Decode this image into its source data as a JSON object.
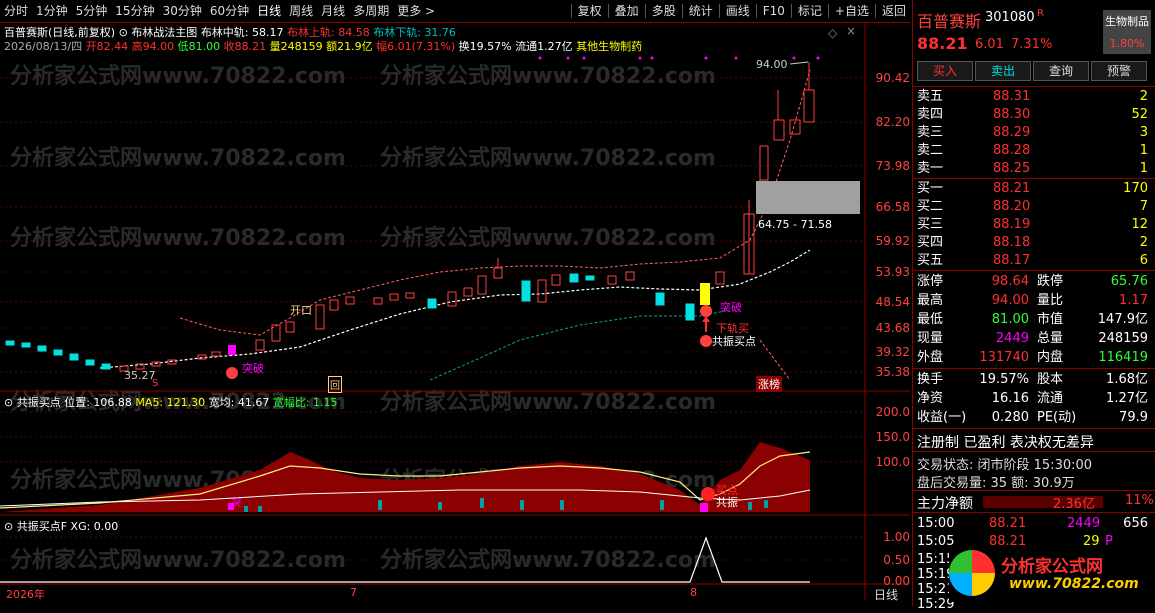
{
  "toolbar": {
    "periods": [
      "分时",
      "1分钟",
      "5分钟",
      "15分钟",
      "30分钟",
      "60分钟",
      "日线",
      "周线",
      "月线",
      "多周期",
      "更多 >"
    ],
    "actions": [
      "复权",
      "叠加",
      "多股",
      "统计",
      "画线",
      "F10",
      "标记",
      "+自选",
      "返回"
    ]
  },
  "header": {
    "stock": "百普赛斯(日线,前复权)",
    "indicator": "布林战法主图",
    "mid_label": "布林中轨: 58.17",
    "up_label": "布林上轨: 84.58",
    "down_label": "布林下轨: 31.76",
    "date": "2026/08/13/四",
    "open": "开82.44",
    "high": "高94.00",
    "low": "低81.00",
    "close": "收88.21",
    "vol": "量248159",
    "amount": "额21.9亿",
    "change": "幅6.01(7.31%)",
    "turnover": "换19.57%",
    "float": "流通1.27亿",
    "sector": "其他生物制药"
  },
  "price_axis": [
    "90.42",
    "82.20",
    "73.98",
    "66.58",
    "59.92",
    "53.93",
    "48.54",
    "43.68",
    "39.32",
    "35.38"
  ],
  "sub_axis1": [
    "200.0",
    "150.0",
    "100.0"
  ],
  "sub_axis2": [
    "1.00",
    "0.50",
    "0.00"
  ],
  "chart_labels": {
    "high_mark": "94.00",
    "gap_range": "64.75 - 71.58",
    "low_mark": "35.27",
    "breakout1": "突破",
    "breakout2": "突破",
    "sell_signal": "下轨买",
    "resonance": "共振买点",
    "limit": "涨榜",
    "open_tag": "开口",
    "s_tag": "S",
    "q_tag": "回",
    "sub_tag1": "共振",
    "sub_tag2": "买点",
    "sub_tag3": "突",
    "watermark": "分析家公式网www.70822.com"
  },
  "sub1": {
    "title": "共振买点",
    "pos": "位置: 106.88",
    "ma5": "MA5: 121.30",
    "width": "宽均: 41.67",
    "ratio": "宽幅比: 1.15"
  },
  "sub2": {
    "title": "共振买点F",
    "xg": "XG: 0.00"
  },
  "time_axis": [
    "2026年",
    "7",
    "8",
    "日线"
  ],
  "right": {
    "name": "百普赛斯",
    "code": "301080",
    "r_mark": "R",
    "sector": "生物制品",
    "sector_pct": "1.80%",
    "price": "88.21",
    "chg": "6.01",
    "pct": "7.31%",
    "buttons": [
      "买入",
      "卖出",
      "查询",
      "预警"
    ],
    "asks": [
      {
        "label": "卖五",
        "price": "88.31",
        "vol": "2"
      },
      {
        "label": "卖四",
        "price": "88.30",
        "vol": "52"
      },
      {
        "label": "卖三",
        "price": "88.29",
        "vol": "3"
      },
      {
        "label": "卖二",
        "price": "88.28",
        "vol": "1"
      },
      {
        "label": "卖一",
        "price": "88.25",
        "vol": "1"
      }
    ],
    "bids": [
      {
        "label": "买一",
        "price": "88.21",
        "vol": "170"
      },
      {
        "label": "买二",
        "price": "88.20",
        "vol": "7"
      },
      {
        "label": "买三",
        "price": "88.19",
        "vol": "12"
      },
      {
        "label": "买四",
        "price": "88.18",
        "vol": "2"
      },
      {
        "label": "买五",
        "price": "88.17",
        "vol": "6"
      }
    ],
    "stats": [
      {
        "l1": "涨停",
        "v1": "98.64",
        "l2": "跌停",
        "v2": "65.76"
      },
      {
        "l1": "最高",
        "v1": "94.00",
        "l2": "量比",
        "v2": "1.17"
      },
      {
        "l1": "最低",
        "v1": "81.00",
        "l2": "市值",
        "v2": "147.9亿"
      },
      {
        "l1": "现量",
        "v1": "2449",
        "l2": "总量",
        "v2": "248159"
      },
      {
        "l1": "外盘",
        "v1": "131740",
        "l2": "内盘",
        "v2": "116419"
      }
    ],
    "stats2": [
      {
        "l1": "换手",
        "v1": "19.57%",
        "l2": "股本",
        "v2": "1.68亿"
      },
      {
        "l1": "净资",
        "v1": "16.16",
        "l2": "流通",
        "v2": "1.27亿"
      },
      {
        "l1": "收益(一)",
        "v1": "0.280",
        "l2": "PE(动)",
        "v2": "79.9"
      }
    ],
    "reg": "注册制 已盈利 表决权无差异",
    "status": "交易状态: 闭市阶段 15:30:00",
    "after": "盘后交易量: 35  额: 30.9万",
    "mainflow_label": "主力净额",
    "mainflow": "2.36亿",
    "mainflow_pct": "11%",
    "ticks": [
      {
        "t": "15:00",
        "p": "88.21",
        "v": "2449",
        "n": "656"
      },
      {
        "t": "15:05",
        "p": "88.21",
        "v": "29",
        "n": "P"
      },
      {
        "t": "15:15",
        "p": "",
        "v": "",
        "n": ""
      },
      {
        "t": "15:19",
        "p": "",
        "v": "",
        "n": ""
      },
      {
        "t": "15:21",
        "p": "",
        "v": "",
        "n": ""
      },
      {
        "t": "15:29",
        "p": "",
        "v": "",
        "n": ""
      }
    ],
    "logo_text": "分析家公式网",
    "logo_url": "www.70822.com"
  }
}
